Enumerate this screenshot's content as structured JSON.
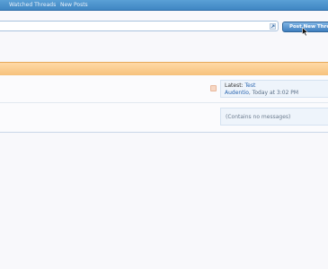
{
  "nav": {
    "items": [
      {
        "label": "Watched Threads"
      },
      {
        "label": "New Posts"
      }
    ]
  },
  "toolbar": {
    "post_button_label": "Post New Thread"
  },
  "forum_rows": [
    {
      "latest_prefix": "Latest:",
      "latest_title": "Test",
      "latest_user": "Audentio",
      "latest_time": ", Today at 3:02 PM"
    },
    {
      "empty_text": "(Contains no messages)"
    }
  ],
  "icons": {
    "popup": "popup-arrow-icon",
    "rss": "rss-icon",
    "cursor": "mouse-cursor-icon"
  },
  "colors": {
    "nav_bar": "#4a92cc",
    "section_bar": "#f8cf95",
    "link": "#2a66b0",
    "button": "#4f8fcf"
  }
}
